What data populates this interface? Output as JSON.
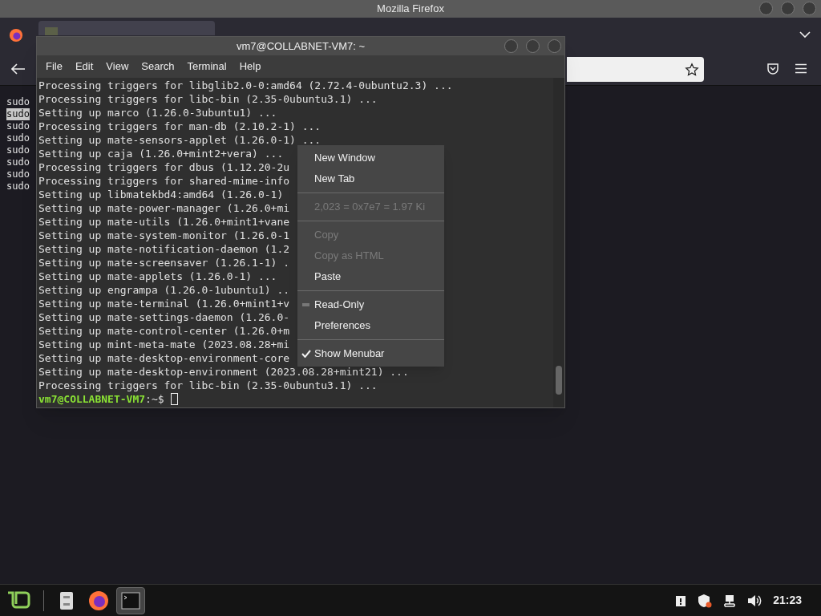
{
  "firefox": {
    "title": "Mozilla Firefox",
    "content_lines": [
      {
        "text": "sudo",
        "selected": false
      },
      {
        "text": "sudo",
        "selected": true
      },
      {
        "text": "sudo",
        "selected": false
      },
      {
        "text": "sudo",
        "selected": false
      },
      {
        "text": "sudo",
        "selected": false
      },
      {
        "text": "sudo",
        "selected": false
      },
      {
        "text": "sudo",
        "selected": false
      },
      {
        "text": "sudo",
        "selected": false
      }
    ]
  },
  "terminal": {
    "title": "vm7@COLLABNET-VM7: ~",
    "menu": [
      "File",
      "Edit",
      "View",
      "Search",
      "Terminal",
      "Help"
    ],
    "lines": [
      "Processing triggers for libglib2.0-0:amd64 (2.72.4-0ubuntu2.3) ...",
      "Processing triggers for libc-bin (2.35-0ubuntu3.1) ...",
      "Setting up marco (1.26.0-3ubuntu1) ...",
      "Processing triggers for man-db (2.10.2-1) ...",
      "Setting up mate-sensors-applet (1.26.0-1) ...",
      "Setting up caja (1.26.0+mint2+vera) ...",
      "Processing triggers for dbus (1.12.20-2u",
      "Processing triggers for shared-mime-info",
      "Setting up libmatekbd4:amd64 (1.26.0-1)",
      "Setting up mate-power-manager (1.26.0+mi",
      "Setting up mate-utils (1.26.0+mint1+vane",
      "Setting up mate-system-monitor (1.26.0-1",
      "Setting up mate-notification-daemon (1.2",
      "Setting up mate-screensaver (1.26.1-1) .",
      "Setting up mate-applets (1.26.0-1) ...",
      "Setting up engrampa (1.26.0-1ubuntu1) ..",
      "Setting up mate-terminal (1.26.0+mint1+v",
      "Setting up mate-settings-daemon (1.26.0-",
      "Setting up mate-control-center (1.26.0+m",
      "Setting up mint-meta-mate (2023.08.28+mi",
      "Setting up mate-desktop-environment-core",
      "Setting up mate-desktop-environment (2023.08.28+mint21) ...",
      "Processing triggers for libc-bin (2.35-0ubuntu3.1) ..."
    ],
    "prompt_user": "vm7@COLLABNET-VM7",
    "prompt_path": ":~$"
  },
  "context_menu": [
    {
      "kind": "item",
      "label": "New Window",
      "disabled": false
    },
    {
      "kind": "item",
      "label": "New Tab",
      "disabled": false
    },
    {
      "kind": "separator"
    },
    {
      "kind": "item",
      "label": "2,023 = 0x7e7 = 1.97 Ki",
      "disabled": true
    },
    {
      "kind": "separator"
    },
    {
      "kind": "item",
      "label": "Copy",
      "disabled": true
    },
    {
      "kind": "item",
      "label": "Copy as HTML",
      "disabled": true
    },
    {
      "kind": "item",
      "label": "Paste",
      "disabled": false
    },
    {
      "kind": "separator"
    },
    {
      "kind": "check",
      "label": "Read-Only",
      "checked": false
    },
    {
      "kind": "item",
      "label": "Preferences",
      "disabled": false
    },
    {
      "kind": "separator"
    },
    {
      "kind": "check",
      "label": "Show Menubar",
      "checked": true
    }
  ],
  "taskbar": {
    "clock": "21:23",
    "apps": [
      {
        "kind": "files",
        "selected": false
      },
      {
        "kind": "firefox",
        "selected": false
      },
      {
        "kind": "terminal",
        "selected": true
      }
    ]
  }
}
